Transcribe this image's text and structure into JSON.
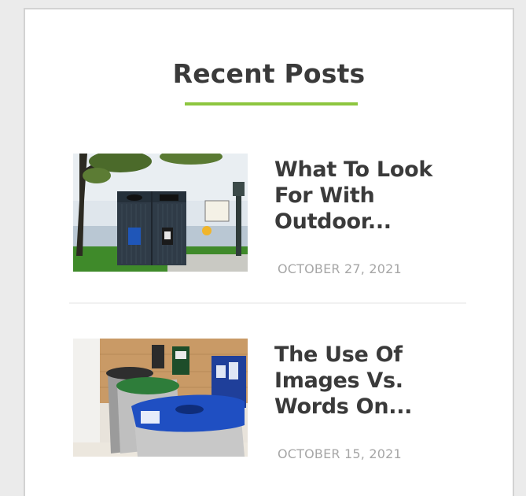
{
  "widget": {
    "title": "Recent Posts",
    "accent_color": "#8dc63f"
  },
  "posts": [
    {
      "title": "What To Look For With Outdoor...",
      "date": "OCTOBER 27, 2021",
      "thumbnail": "outdoor-recycling-bin-photo"
    },
    {
      "title": "The Use Of Images Vs. Words On...",
      "date": "OCTOBER 15, 2021",
      "thumbnail": "indoor-recycling-bins-photo"
    }
  ]
}
